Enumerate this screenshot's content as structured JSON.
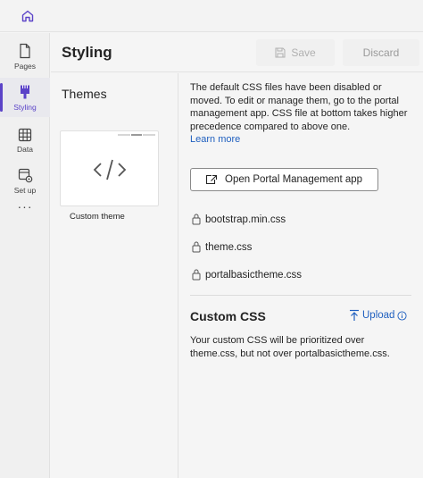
{
  "header": {
    "title": "Styling",
    "save_label": "Save",
    "discard_label": "Discard"
  },
  "rail": {
    "items": [
      {
        "label": "Pages",
        "icon": "page-icon"
      },
      {
        "label": "Styling",
        "icon": "paintbrush-icon",
        "active": true
      },
      {
        "label": "Data",
        "icon": "table-icon"
      },
      {
        "label": "Set up",
        "icon": "settings-icon"
      }
    ],
    "more": "···"
  },
  "themes": {
    "title": "Themes",
    "items": [
      {
        "name": "Custom theme",
        "icon": "code-icon"
      }
    ]
  },
  "main": {
    "intro": "The default CSS files have been disabled or moved. To edit or manage them, go to the portal management app. CSS file at bottom takes higher precedence compared to above one.",
    "learn_more": "Learn more",
    "open_button": "Open Portal Management app",
    "css_files": [
      "bootstrap.min.css",
      "theme.css",
      "portalbasictheme.css"
    ],
    "custom_css": {
      "title": "Custom CSS",
      "upload_label": "Upload",
      "description": "Your custom CSS will be prioritized over theme.css, but not over portalbasictheme.css."
    }
  },
  "colors": {
    "accent": "#5b43c8",
    "link": "#1f5fbf"
  }
}
